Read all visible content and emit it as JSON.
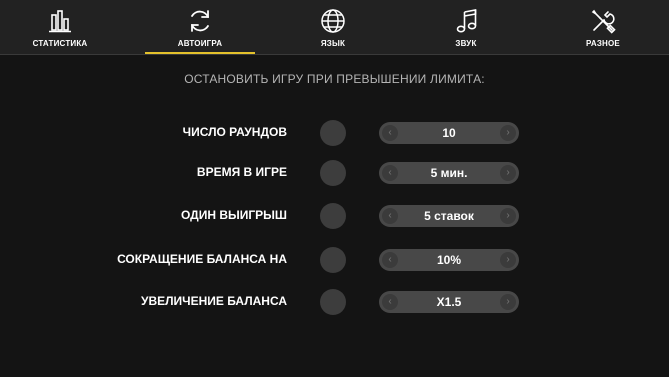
{
  "tabs": [
    {
      "label": "СТАТИСТИКА",
      "icon": "bar-chart-icon",
      "active": false
    },
    {
      "label": "АВТОИГРА",
      "icon": "refresh-icon",
      "active": true
    },
    {
      "label": "ЯЗЫК",
      "icon": "globe-icon",
      "active": false
    },
    {
      "label": "ЗВУК",
      "icon": "music-note-icon",
      "active": false
    },
    {
      "label": "РАЗНОЕ",
      "icon": "tools-icon",
      "active": false
    }
  ],
  "accent_color": "#e4c22c",
  "heading": "ОСТАНОВИТЬ ИГРУ ПРИ ПРЕВЫШЕНИИ ЛИМИТА:",
  "settings": [
    {
      "label": "ЧИСЛО РАУНДОВ",
      "value": "10"
    },
    {
      "label": "ВРЕМЯ В ИГРЕ",
      "value": "5 мин."
    },
    {
      "label": "ОДИН ВЫИГРЫШ",
      "value": "5 ставок"
    },
    {
      "label": "СОКРАЩЕНИЕ БАЛАНСА НА",
      "value": "10%"
    },
    {
      "label": "УВЕЛИЧЕНИЕ БАЛАНСА",
      "value": "X1.5"
    }
  ],
  "arrows": {
    "left": "‹",
    "right": "›"
  }
}
